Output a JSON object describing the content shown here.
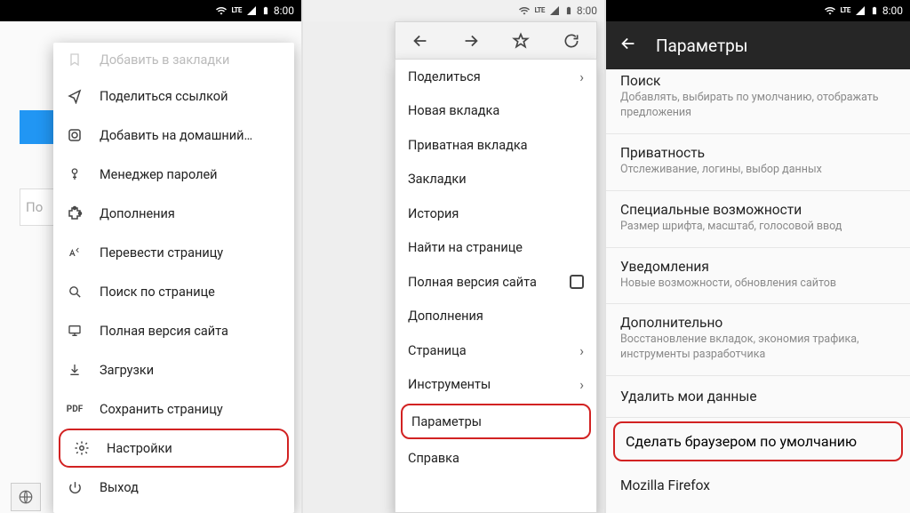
{
  "status": {
    "time": "8:00",
    "lte": "LTE"
  },
  "panel1": {
    "search_stub": "По",
    "items": [
      {
        "icon": "bookmark",
        "label": "Добавить в закладки",
        "faded": true
      },
      {
        "icon": "share",
        "label": "Поделиться ссылкой"
      },
      {
        "icon": "home-add",
        "label": "Добавить на домашний…"
      },
      {
        "icon": "key",
        "label": "Менеджер паролей"
      },
      {
        "icon": "puzzle",
        "label": "Дополнения"
      },
      {
        "icon": "translate",
        "label": "Перевести страницу"
      },
      {
        "icon": "find",
        "label": "Поиск по странице"
      },
      {
        "icon": "desktop",
        "label": "Полная версия сайта"
      },
      {
        "icon": "download",
        "label": "Загрузки"
      },
      {
        "icon": "pdf",
        "label": "Сохранить страницу"
      },
      {
        "icon": "gear",
        "label": "Настройки",
        "highlight": true
      },
      {
        "icon": "power",
        "label": "Выход"
      }
    ]
  },
  "panel2": {
    "items": [
      {
        "label": "Поделиться",
        "chev": true
      },
      {
        "label": "Новая вкладка"
      },
      {
        "label": "Приватная вкладка"
      },
      {
        "label": "Закладки"
      },
      {
        "label": "История"
      },
      {
        "label": "Найти на странице"
      },
      {
        "label": "Полная версия сайта",
        "checkbox": true
      },
      {
        "label": "Дополнения"
      },
      {
        "label": "Страница",
        "chev": true
      },
      {
        "label": "Инструменты",
        "chev": true
      },
      {
        "label": "Параметры",
        "highlight": true
      },
      {
        "label": "Справка"
      }
    ]
  },
  "panel3": {
    "title": "Параметры",
    "sections": [
      {
        "title": "Поиск",
        "sub": "Добавлять, выбирать по умолчанию, отображать предложения"
      },
      {
        "title": "Приватность",
        "sub": "Отслеживание, логины, выбор данных"
      },
      {
        "title": "Специальные возможности",
        "sub": "Размер шрифта, масштаб, голосовой ввод"
      },
      {
        "title": "Уведомления",
        "sub": "Новые возможности, обновления сайтов"
      },
      {
        "title": "Дополнительно",
        "sub": "Восстановление вкладок, экономия трафика, инструменты разработчика"
      }
    ],
    "actions": [
      {
        "label": "Удалить мои данные"
      },
      {
        "label": "Сделать браузером по умолчанию",
        "highlight": true
      },
      {
        "label": "Mozilla Firefox"
      }
    ]
  }
}
